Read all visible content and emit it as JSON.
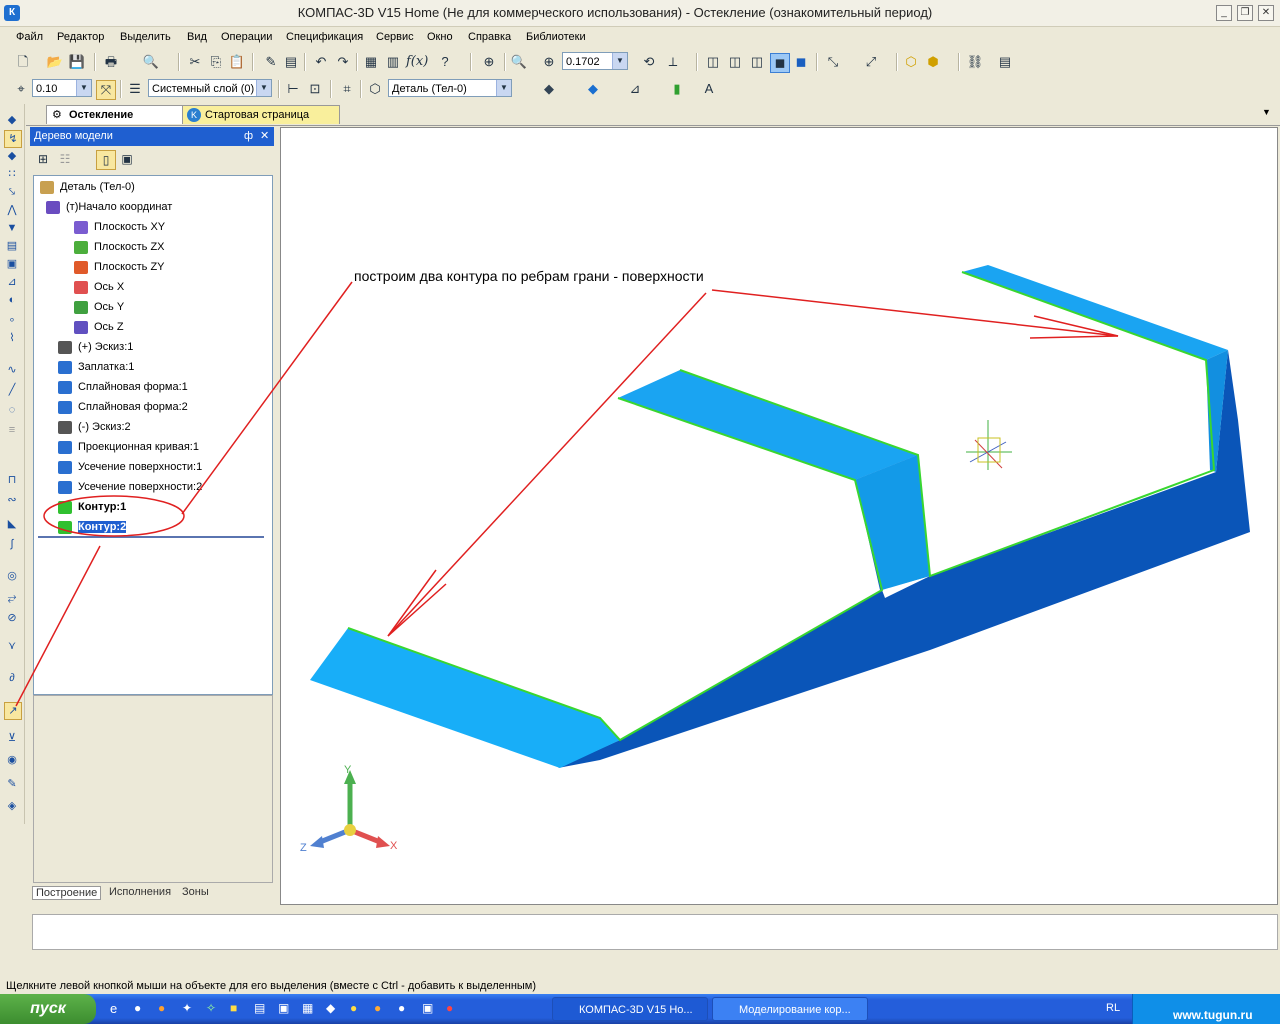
{
  "window": {
    "title": "КОМПАС-3D V15 Home (Не для коммерческого использования) - Остекление (ознакомительный период)",
    "app_icon": "К"
  },
  "menu": [
    "Файл",
    "Редактор",
    "Выделить",
    "Вид",
    "Операции",
    "Спецификация",
    "Сервис",
    "Окно",
    "Справка",
    "Библиотеки"
  ],
  "toolbar1": {
    "zoom_value": "0.1702"
  },
  "toolbar2": {
    "step_value": "0.10",
    "layer": "Системный слой (0)",
    "detail": "Деталь (Тел-0)"
  },
  "tabs": [
    {
      "label": "Остекление",
      "active": true
    },
    {
      "label": "Стартовая страница",
      "active": false
    }
  ],
  "tree_panel": {
    "title": "Дерево модели",
    "pin": "ф",
    "close": "✕",
    "items": [
      {
        "label": "Деталь (Тел-0)",
        "icon": "part-icon",
        "color": "#c8a050"
      },
      {
        "label": "(т)Начало координат",
        "icon": "origin-icon",
        "color": "#6a4cc0"
      },
      {
        "label": "Плоскость XY",
        "icon": "plane-xy-icon",
        "color": "#7a5cd0"
      },
      {
        "label": "Плоскость ZX",
        "icon": "plane-zx-icon",
        "color": "#4cae3c"
      },
      {
        "label": "Плоскость ZY",
        "icon": "plane-zy-icon",
        "color": "#e05a2a"
      },
      {
        "label": "Ось X",
        "icon": "axis-x-icon",
        "color": "#e05050"
      },
      {
        "label": "Ось Y",
        "icon": "axis-y-icon",
        "color": "#40a040"
      },
      {
        "label": "Ось Z",
        "icon": "axis-z-icon",
        "color": "#6050c0"
      },
      {
        "label": "(+) Эскиз:1",
        "icon": "sketch-icon",
        "color": "#555555"
      },
      {
        "label": "Заплатка:1",
        "icon": "patch-icon",
        "color": "#2a6fd0"
      },
      {
        "label": "Сплайновая форма:1",
        "icon": "spline-form-icon",
        "color": "#2a6fd0"
      },
      {
        "label": "Сплайновая форма:2",
        "icon": "spline-form-icon",
        "color": "#2a6fd0"
      },
      {
        "label": "(-) Эскиз:2",
        "icon": "sketch-icon",
        "color": "#555555"
      },
      {
        "label": "Проекционная кривая:1",
        "icon": "projection-curve-icon",
        "color": "#2a6fd0"
      },
      {
        "label": "Усечение поверхности:1",
        "icon": "trim-surface-icon",
        "color": "#2a6fd0"
      },
      {
        "label": "Усечение поверхности:2",
        "icon": "trim-surface-icon",
        "color": "#2a6fd0"
      },
      {
        "label": "Контур:1",
        "icon": "contour-icon",
        "color": "#30c030"
      },
      {
        "label": "Контур:2",
        "icon": "contour-icon",
        "color": "#30c030"
      }
    ],
    "bottom_tabs": [
      "Построение",
      "Исполнения",
      "Зоны"
    ]
  },
  "annotation": "построим два контура по ребрам грани - поверхности",
  "axes": {
    "x": "X",
    "y": "Y",
    "z": "Z"
  },
  "colors": {
    "surface_light": "#21a8f5",
    "surface_dark": "#0a55b8",
    "edge": "#39d630",
    "annotation": "#e02020",
    "selection": "#1f5fd0"
  },
  "status": "Щелкните левой кнопкой мыши на объекте для его выделения (вместе с Ctrl - добавить к выделенным)",
  "taskbar": {
    "start": "пуск",
    "tasks": [
      "КОМПАС-3D V15 Ho...",
      "Моделирование кор..."
    ],
    "lang": "RL",
    "site": "www.tugun.ru"
  }
}
